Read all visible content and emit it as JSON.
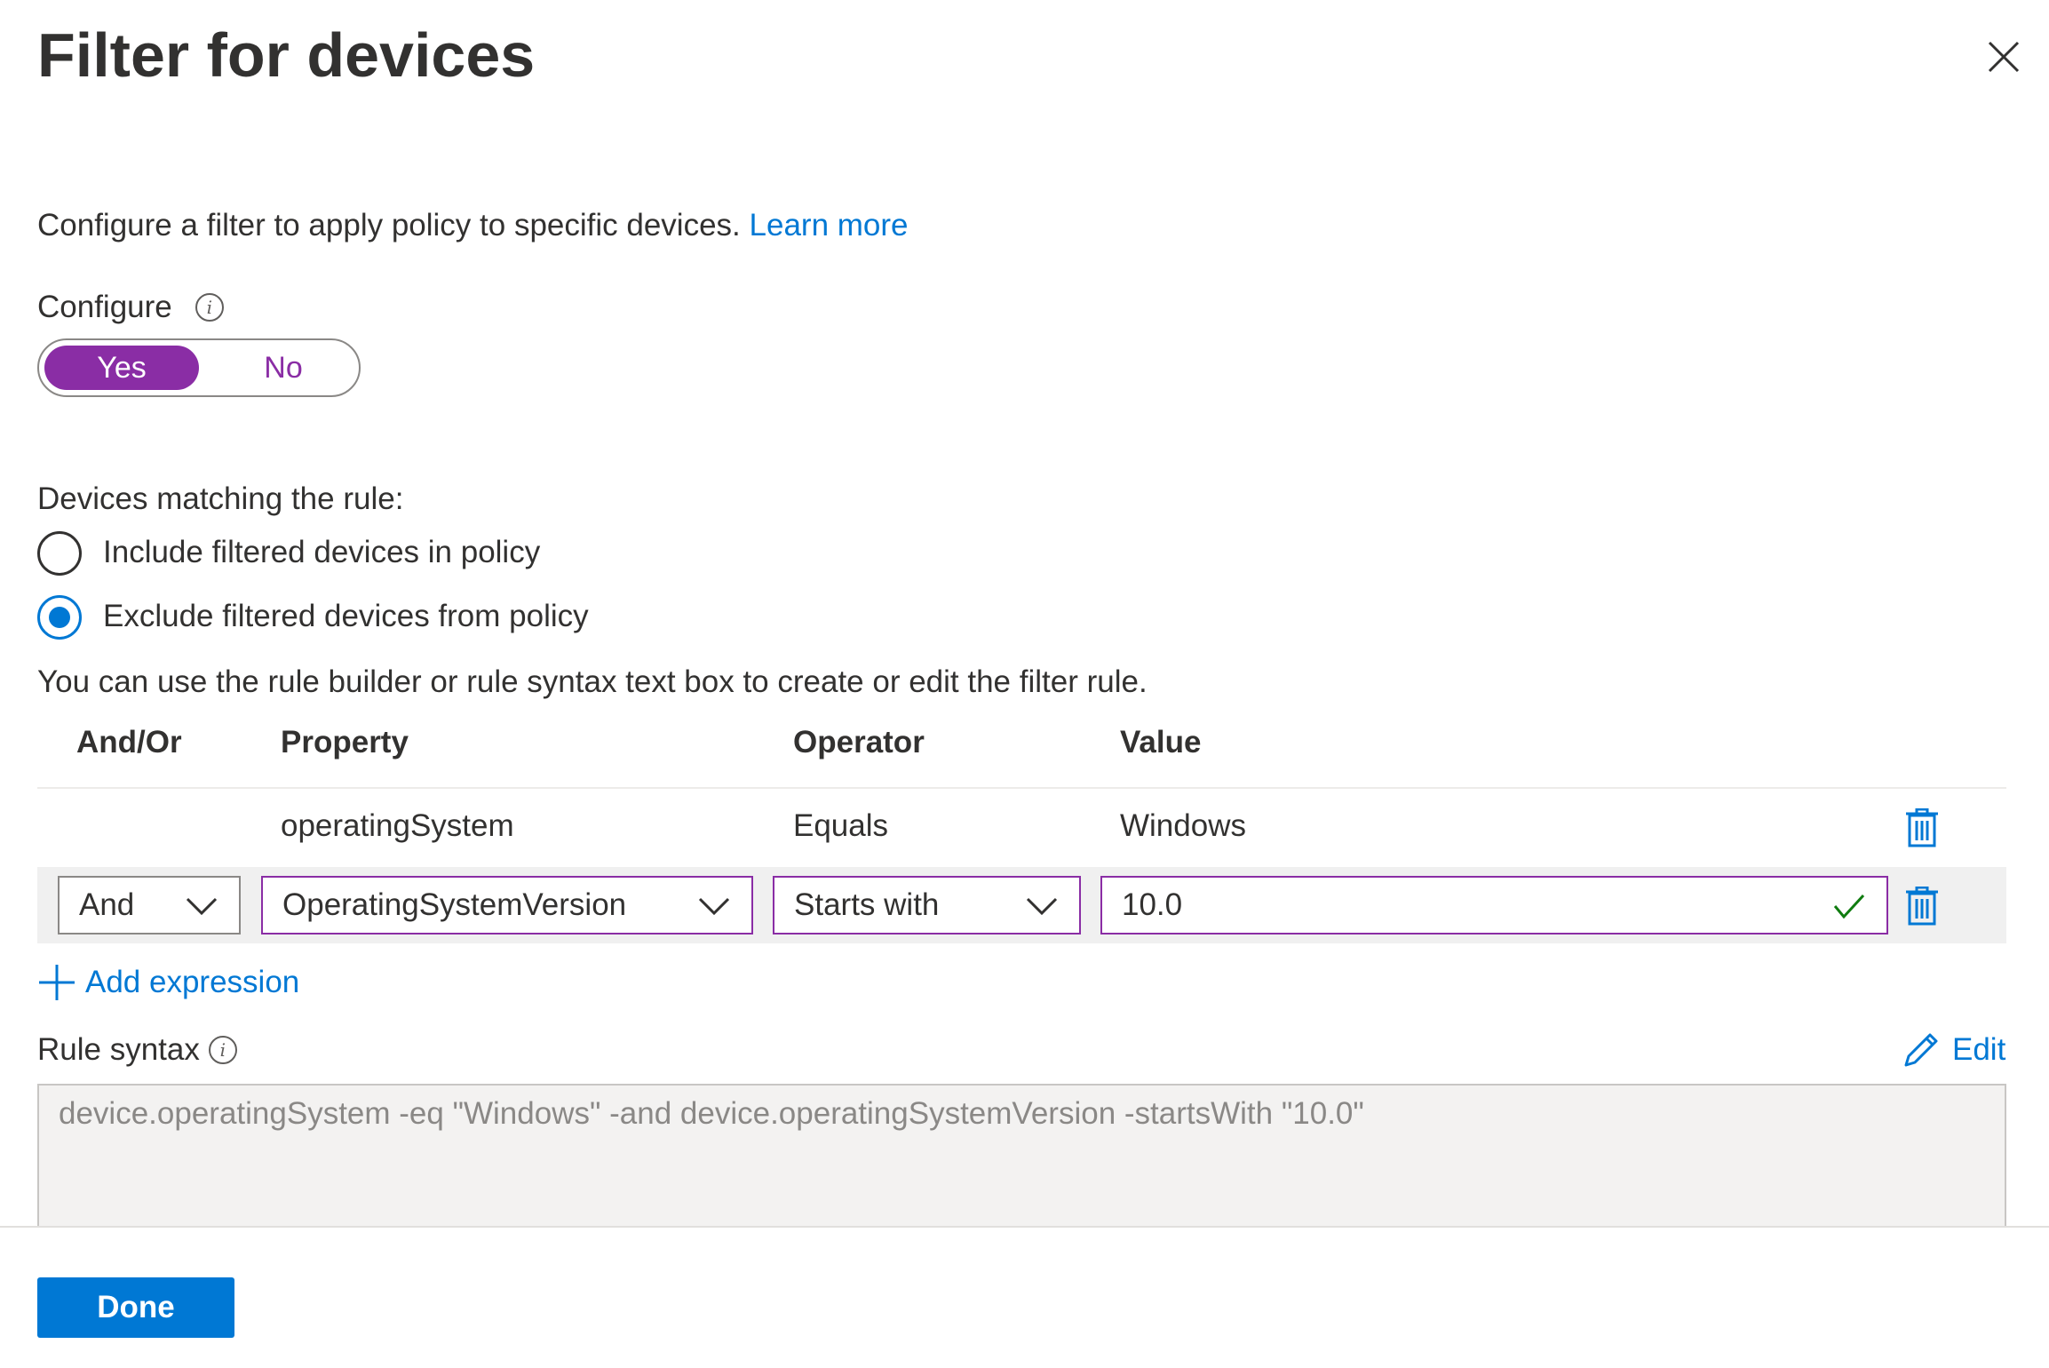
{
  "panel": {
    "title": "Filter for devices",
    "description": "Configure a filter to apply policy to specific devices.",
    "learn_more": "Learn more"
  },
  "configure": {
    "label": "Configure",
    "yes": "Yes",
    "no": "No",
    "selected": "Yes"
  },
  "matching": {
    "label": "Devices matching the rule:",
    "include": "Include filtered devices in policy",
    "exclude": "Exclude filtered devices from policy",
    "selected": "exclude"
  },
  "builder_hint": "You can use the rule builder or rule syntax text box to create or edit the filter rule.",
  "table": {
    "headers": [
      "And/Or",
      "Property",
      "Operator",
      "Value"
    ],
    "rows": [
      {
        "andor": "",
        "property": "operatingSystem",
        "operator": "Equals",
        "value": "Windows"
      },
      {
        "andor": "And",
        "property": "OperatingSystemVersion",
        "operator": "Starts with",
        "value": "10.0"
      }
    ]
  },
  "add_expression": "Add expression",
  "rule_syntax": {
    "label": "Rule syntax",
    "edit": "Edit",
    "text": "device.operatingSystem -eq \"Windows\" -and device.operatingSystemVersion -startsWith \"10.0\""
  },
  "done_label": "Done",
  "colors": {
    "accent_blue": "#0078d4",
    "toggle_purple": "#8a2da5",
    "valid_green": "#107c10"
  }
}
